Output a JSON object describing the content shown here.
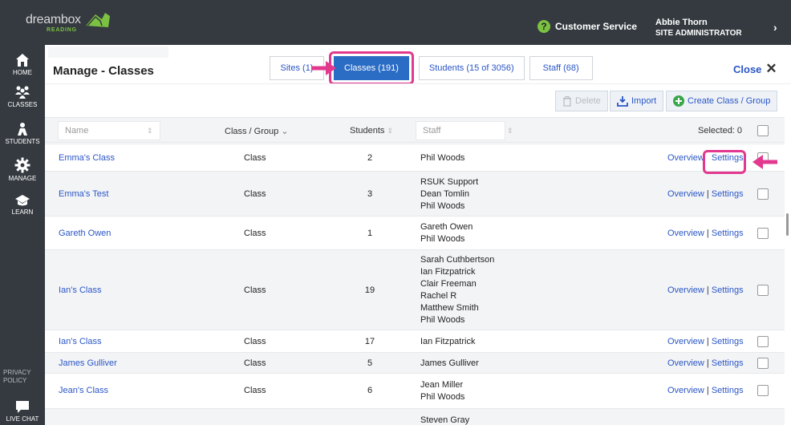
{
  "brand": {
    "name": "dreambox",
    "sub": "READING"
  },
  "header": {
    "customer_service": "Customer Service",
    "user_name": "Abbie Thorn",
    "user_role": "SITE ADMINISTRATOR",
    "help_icon": "question-circle-icon",
    "chevron": "chevron-right-icon"
  },
  "sidebar": {
    "items": [
      {
        "label": "HOME",
        "icon": "home-icon"
      },
      {
        "label": "CLASSES",
        "icon": "classes-icon"
      },
      {
        "label": "STUDENTS",
        "icon": "student-icon"
      },
      {
        "label": "MANAGE",
        "icon": "gear-icon"
      },
      {
        "label": "LEARN",
        "icon": "graduation-cap-icon"
      }
    ],
    "privacy": "PRIVACY POLICY",
    "live_chat": "LIVE CHAT"
  },
  "page": {
    "title": "Manage - Classes",
    "close_label": "Close"
  },
  "tabs": [
    {
      "label": "Sites (1)",
      "active": false
    },
    {
      "label": "Classes (191)",
      "active": true
    },
    {
      "label": "Students (15 of 3056)",
      "active": false
    },
    {
      "label": "Staff (68)",
      "active": false
    }
  ],
  "actions": {
    "delete": "Delete",
    "import": "Import",
    "create": "Create Class / Group"
  },
  "table": {
    "headers": {
      "name_placeholder": "Name",
      "type": "Class / Group",
      "students": "Students",
      "staff_placeholder": "Staff",
      "selected": "Selected: 0"
    },
    "link_overview": "Overview",
    "link_sep": "|",
    "link_settings": "Settings",
    "rows": [
      {
        "name": "Emma's Class",
        "type": "Class",
        "students": "2",
        "staff": [
          "Phil Woods"
        ]
      },
      {
        "name": "Emma's Test",
        "type": "Class",
        "students": "3",
        "staff": [
          "RSUK Support",
          "Dean Tomlin",
          "Phil Woods"
        ]
      },
      {
        "name": "Gareth Owen",
        "type": "Class",
        "students": "1",
        "staff": [
          "Gareth Owen",
          "Phil Woods"
        ]
      },
      {
        "name": "Ian's Class",
        "type": "Class",
        "students": "19",
        "staff": [
          "Sarah Cuthbertson",
          "Ian Fitzpatrick",
          "Clair Freeman",
          "Rachel R",
          "Matthew Smith",
          "Phil Woods"
        ]
      },
      {
        "name": "Ian's Class",
        "type": "Class",
        "students": "17",
        "staff": [
          "Ian Fitzpatrick"
        ]
      },
      {
        "name": "James Gulliver",
        "type": "Class",
        "students": "5",
        "staff": [
          "James Gulliver"
        ]
      },
      {
        "name": "Jean's Class",
        "type": "Class",
        "students": "6",
        "staff": [
          "Jean Miller",
          "Phil Woods"
        ]
      },
      {
        "name": "",
        "type": "",
        "students": "",
        "staff": [
          "Steven Gray"
        ]
      }
    ]
  },
  "colors": {
    "accent": "#2b6cc4",
    "highlight": "#e2398f",
    "link": "#2a56c6",
    "sidebar": "#343a40"
  }
}
